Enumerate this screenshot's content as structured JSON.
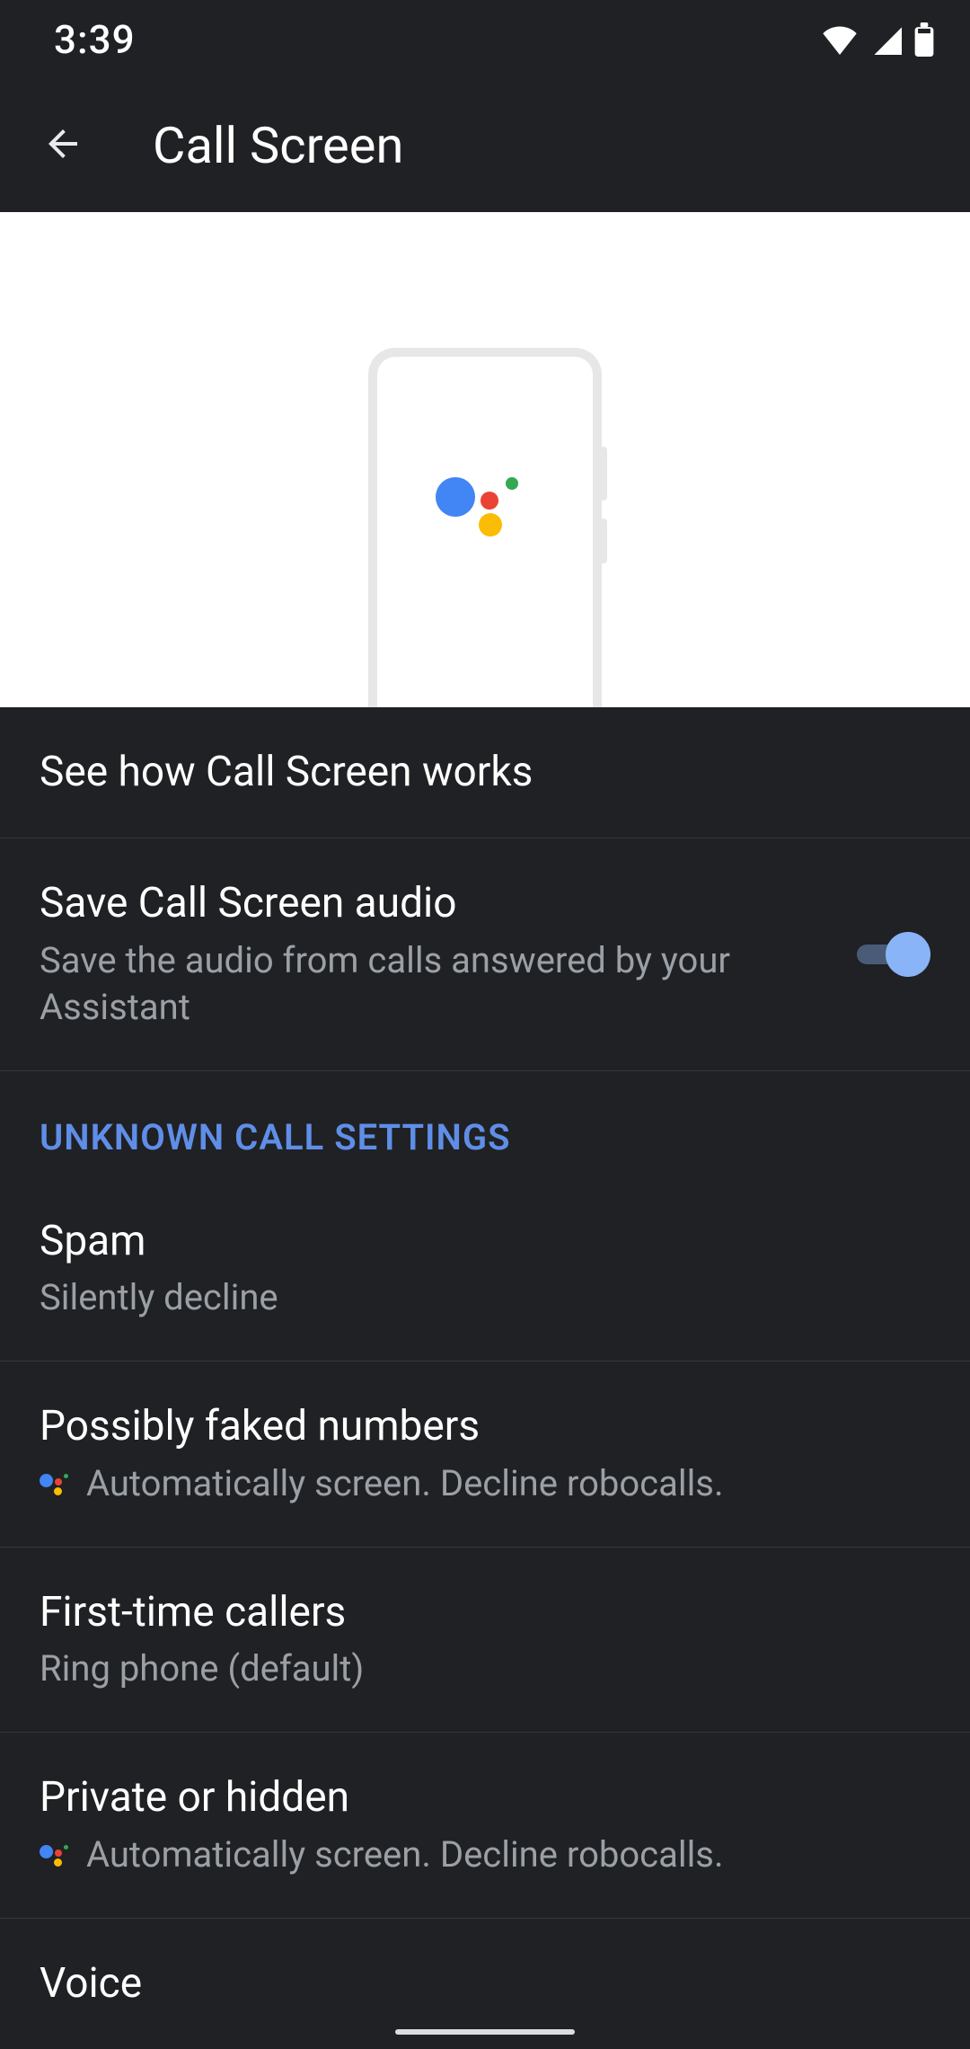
{
  "status": {
    "time": "3:39"
  },
  "appbar": {
    "title": "Call Screen"
  },
  "rows": {
    "howitworks": {
      "title": "See how Call Screen works"
    },
    "saveaudio": {
      "title": "Save Call Screen audio",
      "sub": "Save the audio from calls answered by your Assistant",
      "toggle": true
    }
  },
  "section": {
    "unknown": "UNKNOWN CALL SETTINGS"
  },
  "unknown": {
    "spam": {
      "title": "Spam",
      "sub": "Silently decline"
    },
    "faked": {
      "title": "Possibly faked numbers",
      "sub": "Automatically screen. Decline robocalls."
    },
    "first": {
      "title": "First-time callers",
      "sub": "Ring phone (default)"
    },
    "private": {
      "title": "Private or hidden",
      "sub": "Automatically screen. Decline robocalls."
    }
  },
  "voice": {
    "title": "Voice"
  }
}
